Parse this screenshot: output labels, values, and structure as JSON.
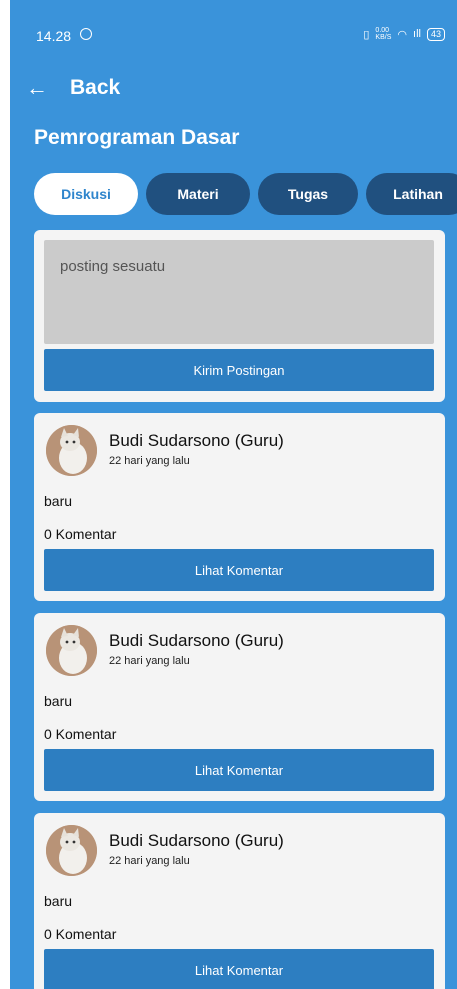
{
  "status": {
    "time": "14.28",
    "net_speed": "0.00 KB/S",
    "signal": "ıll",
    "battery": "43"
  },
  "nav": {
    "back_label": "Back",
    "back_icon": "arrow-left-icon"
  },
  "page": {
    "title": "Pemrograman Dasar"
  },
  "tabs": [
    {
      "label": "Diskusi",
      "active": true
    },
    {
      "label": "Materi",
      "active": false
    },
    {
      "label": "Tugas",
      "active": false
    },
    {
      "label": "Latihan",
      "active": false
    }
  ],
  "composer": {
    "placeholder": "posting sesuatu",
    "submit_label": "Kirim Postingan"
  },
  "posts": [
    {
      "author": "Budi Sudarsono (Guru)",
      "time": "22 hari yang lalu",
      "content": "baru",
      "comments": "0 Komentar",
      "button": "Lihat Komentar"
    },
    {
      "author": "Budi Sudarsono (Guru)",
      "time": "22 hari yang lalu",
      "content": "baru",
      "comments": "0 Komentar",
      "button": "Lihat Komentar"
    },
    {
      "author": "Budi Sudarsono (Guru)",
      "time": "22 hari yang lalu",
      "content": "baru",
      "comments": "0 Komentar",
      "button": "Lihat Komentar"
    }
  ],
  "colors": {
    "background": "#3a93da",
    "button": "#2d7ec1",
    "tab_inactive": "#20507f",
    "tab_active_text": "#2f85cc"
  }
}
